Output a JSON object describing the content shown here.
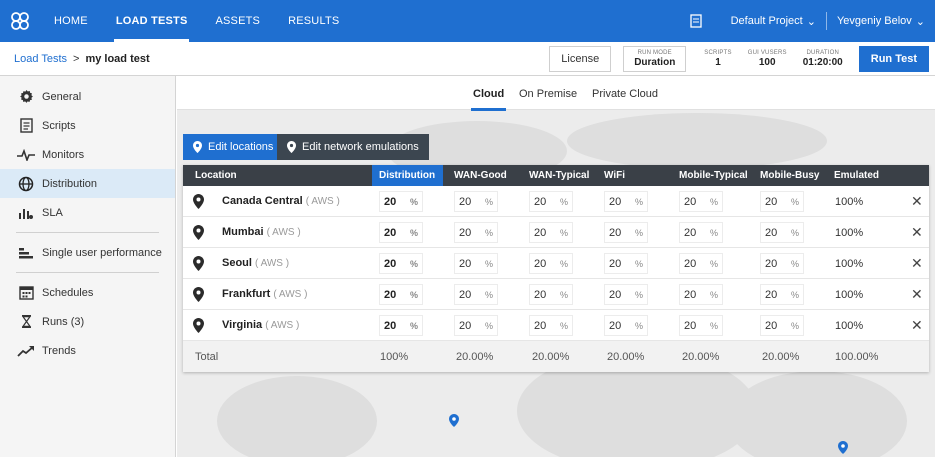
{
  "nav": {
    "items": [
      {
        "label": "HOME",
        "active": false
      },
      {
        "label": "LOAD TESTS",
        "active": true
      },
      {
        "label": "ASSETS",
        "active": false
      },
      {
        "label": "RESULTS",
        "active": false
      }
    ],
    "project": "Default Project",
    "user": "Yevgeniy Belov"
  },
  "breadcrumb": {
    "parent": "Load Tests",
    "separator": ">",
    "current": "my load test"
  },
  "header": {
    "license_label": "License",
    "run_mode": {
      "key": "RUN MODE",
      "value": "Duration"
    },
    "scripts": {
      "key": "SCRIPTS",
      "value": "1"
    },
    "gui_vusers": {
      "key": "GUI VUSERS",
      "value": "100"
    },
    "duration": {
      "key": "DURATION",
      "value": "01:20:00"
    },
    "run_label": "Run Test"
  },
  "sidebar": {
    "items": [
      {
        "label": "General",
        "icon": "gear-icon"
      },
      {
        "label": "Scripts",
        "icon": "document-icon"
      },
      {
        "label": "Monitors",
        "icon": "pulse-icon"
      },
      {
        "label": "Distribution",
        "icon": "globe-icon",
        "active": true
      },
      {
        "label": "SLA",
        "icon": "sla-chart-icon"
      },
      {
        "label": "Single user performance",
        "icon": "single-user-icon"
      },
      {
        "label": "Schedules",
        "icon": "calendar-icon"
      },
      {
        "label": "Runs (3)",
        "icon": "runs-icon"
      },
      {
        "label": "Trends",
        "icon": "trend-icon"
      }
    ]
  },
  "tabs": [
    {
      "label": "Cloud",
      "active": true
    },
    {
      "label": "On Premise",
      "active": false
    },
    {
      "label": "Private Cloud",
      "active": false
    }
  ],
  "actions": {
    "edit_locations": "Edit locations",
    "edit_network": "Edit network emulations"
  },
  "table": {
    "columns": [
      "Location",
      "Distribution",
      "WAN-Good",
      "WAN-Typical",
      "WiFi",
      "Mobile-Typical",
      "Mobile-Busy",
      "Emulated"
    ],
    "percent_sign": "%",
    "delete_glyph": "✕",
    "rows": [
      {
        "name": "Canada Central",
        "provider": "( AWS )",
        "distribution": "20",
        "wan_good": "20",
        "wan_typical": "20",
        "wifi": "20",
        "mobile_typical": "20",
        "mobile_busy": "20",
        "emulated": "100%"
      },
      {
        "name": "Mumbai",
        "provider": "( AWS )",
        "distribution": "20",
        "wan_good": "20",
        "wan_typical": "20",
        "wifi": "20",
        "mobile_typical": "20",
        "mobile_busy": "20",
        "emulated": "100%"
      },
      {
        "name": "Seoul",
        "provider": "( AWS )",
        "distribution": "20",
        "wan_good": "20",
        "wan_typical": "20",
        "wifi": "20",
        "mobile_typical": "20",
        "mobile_busy": "20",
        "emulated": "100%"
      },
      {
        "name": "Frankfurt",
        "provider": "( AWS )",
        "distribution": "20",
        "wan_good": "20",
        "wan_typical": "20",
        "wifi": "20",
        "mobile_typical": "20",
        "mobile_busy": "20",
        "emulated": "100%"
      },
      {
        "name": "Virginia",
        "provider": "( AWS )",
        "distribution": "20",
        "wan_good": "20",
        "wan_typical": "20",
        "wifi": "20",
        "mobile_typical": "20",
        "mobile_busy": "20",
        "emulated": "100%"
      }
    ],
    "total": {
      "label": "Total",
      "distribution": "100%",
      "wan_good": "20.00%",
      "wan_typical": "20.00%",
      "wifi": "20.00%",
      "mobile_typical": "20.00%",
      "mobile_busy": "20.00%",
      "emulated": "100.00%"
    }
  },
  "colors": {
    "brand": "#1f6fd0",
    "table_header": "#3a4047",
    "network_button": "#3c4650"
  }
}
